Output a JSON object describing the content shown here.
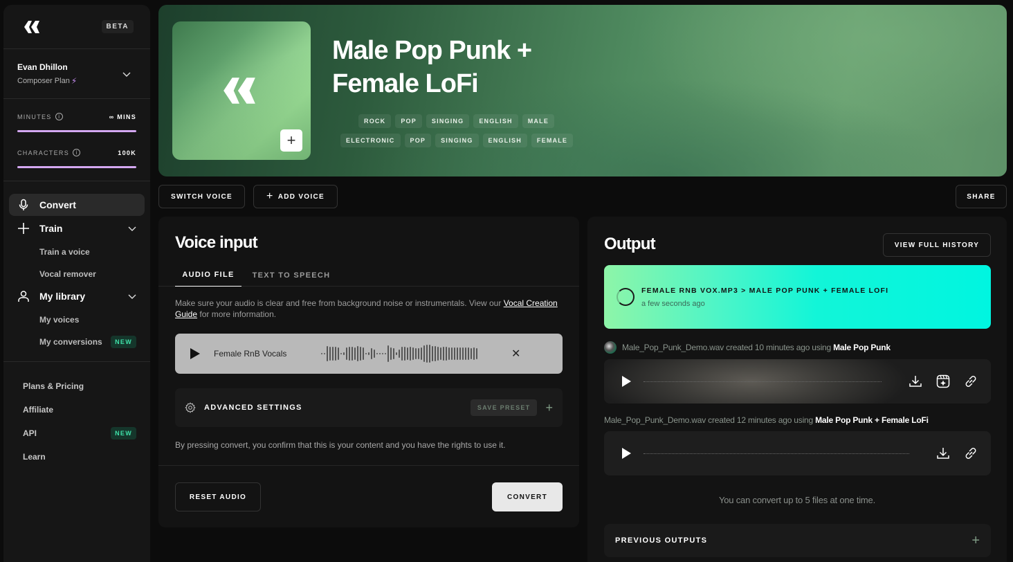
{
  "sidebar": {
    "beta_label": "BETA",
    "user": {
      "name": "Evan Dhillon",
      "plan": "Composer Plan"
    },
    "quota": [
      {
        "label": "MINUTES",
        "value": "∞ MINS",
        "fill": 1.0
      },
      {
        "label": "CHARACTERS",
        "value": "100K",
        "fill": 1.0
      }
    ],
    "nav": {
      "convert": "Convert",
      "train": "Train",
      "train_items": [
        "Train a voice",
        "Vocal remover"
      ],
      "library": "My library",
      "library_items": [
        "My voices",
        "My conversions"
      ],
      "new_badge": "NEW"
    },
    "links": [
      "Plans & Pricing",
      "Affiliate",
      "API",
      "Learn"
    ]
  },
  "hero": {
    "title": "Male Pop Punk + Female LoFi",
    "tags_row1": [
      "ROCK",
      "POP",
      "SINGING",
      "ENGLISH",
      "MALE"
    ],
    "tags_row2": [
      "ELECTRONIC",
      "POP",
      "SINGING",
      "ENGLISH",
      "FEMALE"
    ]
  },
  "actions": {
    "switch_voice": "SWITCH VOICE",
    "add_voice": "ADD VOICE",
    "share": "SHARE"
  },
  "voice_input": {
    "title": "Voice input",
    "tabs": [
      "AUDIO FILE",
      "TEXT TO SPEECH"
    ],
    "help_text": "Make sure your audio is clear and free from background noise or instrumentals. View our ",
    "help_link": "Vocal Creation Guide",
    "help_suffix": " for more information.",
    "file_name": "Female RnB Vocals",
    "advanced_label": "ADVANCED SETTINGS",
    "save_preset": "SAVE PRESET",
    "rights_text": "By pressing convert, you confirm that this is your content and you have the rights to use it.",
    "reset_label": "RESET AUDIO",
    "convert_label": "CONVERT"
  },
  "output": {
    "title": "Output",
    "history_label": "VIEW FULL HISTORY",
    "in_progress": {
      "title": "FEMALE RNB VOX.MP3 > MALE POP PUNK + FEMALE LOFI",
      "time": "a few seconds ago"
    },
    "items": [
      {
        "prefix": "Male_Pop_Punk_Demo.wav created 10 minutes ago using ",
        "voice": "Male Pop Punk"
      },
      {
        "prefix": "Male_Pop_Punk_Demo.wav created 12 minutes ago using ",
        "voice": "Male Pop Punk + Female LoFi"
      }
    ],
    "limit_note": "You can convert up to 5 files at one time.",
    "previous_label": "PREVIOUS OUTPUTS"
  },
  "colors": {
    "accent_purple": "#d4a8f2",
    "new_badge": "#3fe0a8",
    "progress_start": "#8ef5a8",
    "progress_end": "#00f5e0"
  }
}
